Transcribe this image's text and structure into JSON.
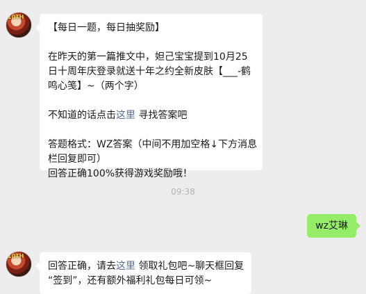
{
  "messages": {
    "first": {
      "title": "【每日一题，每日抽奖励】",
      "question_line1": "在昨天的第一篇推文中，妲己宝宝提到10月25",
      "question_line2": "日十周年庆登录就送十年之约全新皮肤【___-鹤",
      "question_line3": "鸣心笺】~（两个字）",
      "hint_prefix": "不知道的话点击",
      "hint_link": "这里",
      "hint_suffix": " 寻找答案吧",
      "format_line1": "答题格式：WZ答案（中间不用加空格↓下方消息",
      "format_line2": "栏回复即可）",
      "reward_line": "回答正确100%获得游戏奖励哦！"
    },
    "timestamp": "09:38",
    "user_reply": "wz艾琳",
    "second": {
      "line1_prefix": "回答正确，请去",
      "line1_link": "这里",
      "line1_suffix": " 领取礼包吧~聊天框回复",
      "line2": "“签到”，还有额外福利礼包每日可领~"
    }
  },
  "avatar": {
    "badge": "10TH"
  },
  "colors": {
    "background": "#ededed",
    "incoming_bubble": "#ffffff",
    "outgoing_bubble": "#95ec69",
    "link": "#576b95",
    "timestamp": "#b2b2b2"
  }
}
